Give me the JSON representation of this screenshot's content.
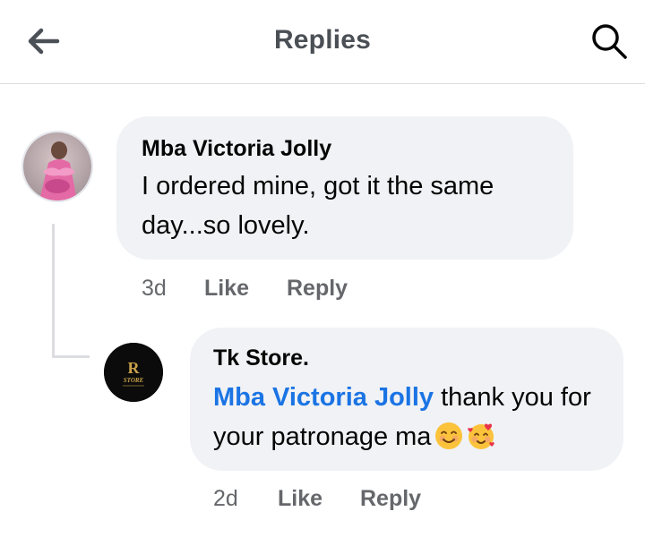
{
  "header": {
    "title": "Replies",
    "back_icon": "arrow-left-icon",
    "search_icon": "search-icon"
  },
  "comments": [
    {
      "author": "Mba Victoria Jolly",
      "text": "I ordered mine, got it the same day...so lovely.",
      "time": "3d",
      "like_label": "Like",
      "reply_label": "Reply",
      "avatar_icon": "profile-photo"
    },
    {
      "author": "Tk Store.",
      "mention": "Mba Victoria Jolly",
      "text": " thank you for your patronage ma",
      "emojis": [
        "smiling-face-icon",
        "smiling-face-with-hearts-icon"
      ],
      "time": "2d",
      "like_label": "Like",
      "reply_label": "Reply",
      "avatar_logo_text": "STORE",
      "avatar_logo_mark": "R"
    }
  ],
  "colors": {
    "bubble": "#f0f2f5",
    "mention": "#1b74e4",
    "meta": "#65676b",
    "logo_gold": "#c9a24a"
  }
}
